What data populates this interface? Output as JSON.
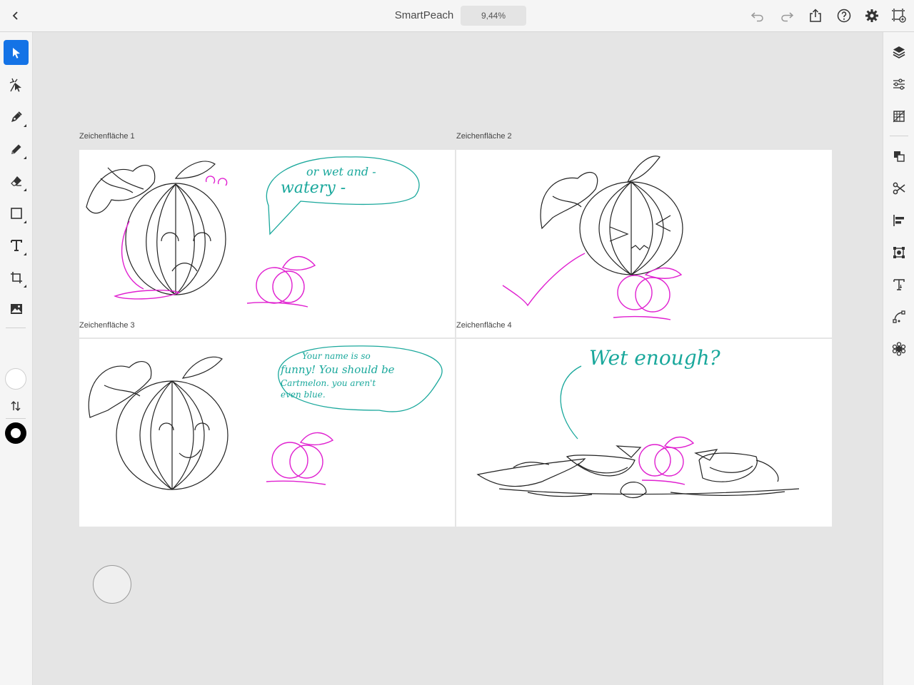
{
  "app": {
    "title": "SmartPeach",
    "zoom": "9,44%"
  },
  "artboards": [
    {
      "label": "Zeichenfläche 1",
      "speech": [
        "or wet and -",
        "watery -"
      ]
    },
    {
      "label": "Zeichenfläche 2"
    },
    {
      "label": "Zeichenfläche 3",
      "speech": [
        "Your name is so",
        "funny! You should be",
        "Cartmelon. you aren't",
        "even blue."
      ]
    },
    {
      "label": "Zeichenfläche 4",
      "speech": [
        "Wet enough?"
      ]
    }
  ],
  "colors": {
    "accent": "#1473e6",
    "ink": "#222222",
    "peach": "#e020d0",
    "teal": "#1aa89c"
  },
  "icons": {
    "top": [
      "chevron-left-icon",
      "undo-icon",
      "redo-icon",
      "share-icon",
      "help-icon",
      "gear-icon",
      "artboard-icon"
    ],
    "left": [
      "select-icon",
      "direct-select-icon",
      "pen-icon",
      "pencil-icon",
      "eraser-icon",
      "rectangle-icon",
      "type-icon",
      "crop-icon",
      "image-icon"
    ],
    "right": [
      "layers-icon",
      "properties-icon",
      "grid-icon",
      "arrange-icon",
      "scissors-icon",
      "align-icon",
      "transform-icon",
      "text-icon",
      "path-icon",
      "effects-icon"
    ]
  }
}
